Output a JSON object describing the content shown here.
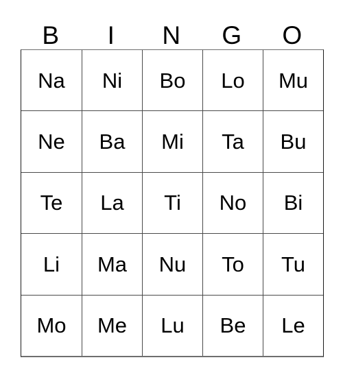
{
  "card": {
    "title": "BINGO",
    "columns": 5,
    "rows": 5,
    "header": [
      {
        "letter": "B"
      },
      {
        "letter": "I"
      },
      {
        "letter": "N"
      },
      {
        "letter": "G"
      },
      {
        "letter": "O"
      }
    ],
    "grid": [
      [
        {
          "value": "Na"
        },
        {
          "value": "Ni"
        },
        {
          "value": "Bo"
        },
        {
          "value": "Lo"
        },
        {
          "value": "Mu"
        }
      ],
      [
        {
          "value": "Ne"
        },
        {
          "value": "Ba"
        },
        {
          "value": "Mi"
        },
        {
          "value": "Ta"
        },
        {
          "value": "Bu"
        }
      ],
      [
        {
          "value": "Te"
        },
        {
          "value": "La"
        },
        {
          "value": "Ti"
        },
        {
          "value": "No"
        },
        {
          "value": "Bi"
        }
      ],
      [
        {
          "value": "Li"
        },
        {
          "value": "Ma"
        },
        {
          "value": "Nu"
        },
        {
          "value": "To"
        },
        {
          "value": "Tu"
        }
      ],
      [
        {
          "value": "Mo"
        },
        {
          "value": "Me"
        },
        {
          "value": "Lu"
        },
        {
          "value": "Be"
        },
        {
          "value": "Le"
        }
      ]
    ],
    "colors": {
      "background": "#ffffff",
      "text": "#000000",
      "grid_line": "#4a4a4a",
      "outer_border": "#1a1a1a"
    }
  }
}
